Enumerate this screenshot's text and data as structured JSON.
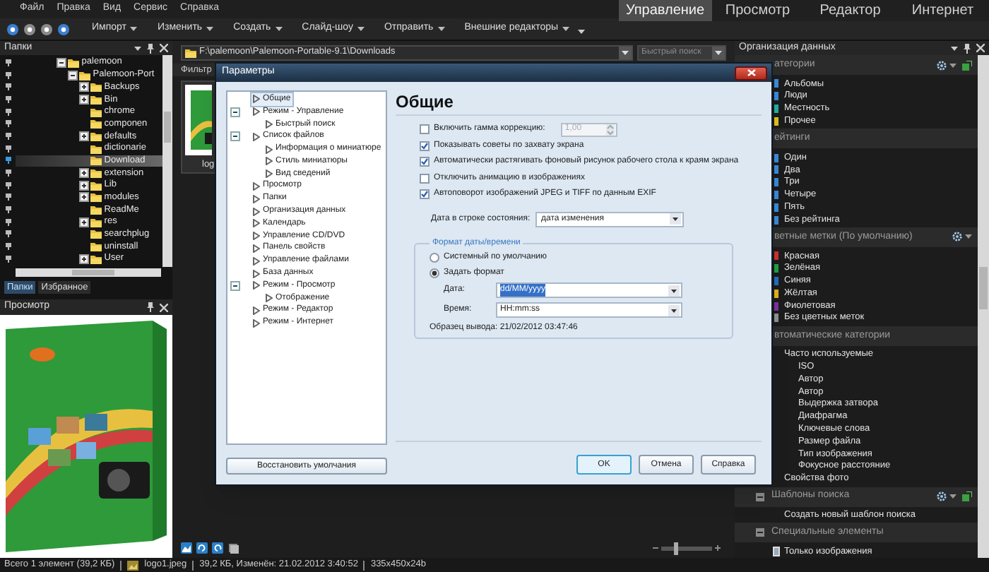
{
  "menu": [
    "Файл",
    "Правка",
    "Вид",
    "Сервис",
    "Справка"
  ],
  "modes": [
    {
      "label": "Управление",
      "selected": true
    },
    {
      "label": "Просмотр",
      "selected": false
    },
    {
      "label": "Редактор",
      "selected": false
    },
    {
      "label": "Интернет",
      "selected": false
    }
  ],
  "toolbar": [
    "Импорт",
    "Изменить",
    "Создать",
    "Слайд-шоу",
    "Отправить",
    "Внешние редакторы"
  ],
  "folders_panel": {
    "title": "Папки",
    "tree": [
      {
        "label": "palemoon",
        "kind": "expanded",
        "selected": false,
        "children": [
          {
            "label": "Palemoon-Port",
            "kind": "expanded",
            "selected": false,
            "children": [
              {
                "label": "Backups",
                "kind": "collapsed",
                "selected": false
              },
              {
                "label": "Bin",
                "kind": "collapsed",
                "selected": false
              },
              {
                "label": "chrome",
                "kind": "leaf",
                "selected": false
              },
              {
                "label": "componen",
                "kind": "leaf",
                "selected": false
              },
              {
                "label": "defaults",
                "kind": "collapsed",
                "selected": false
              },
              {
                "label": "dictionarie",
                "kind": "leaf",
                "selected": false
              },
              {
                "label": "Download",
                "kind": "leaf",
                "selected": true
              },
              {
                "label": "extension",
                "kind": "collapsed",
                "selected": false
              },
              {
                "label": "Lib",
                "kind": "collapsed",
                "selected": false
              },
              {
                "label": "modules",
                "kind": "collapsed",
                "selected": false
              },
              {
                "label": "ReadMe",
                "kind": "leaf",
                "selected": false
              },
              {
                "label": "res",
                "kind": "collapsed",
                "selected": false
              },
              {
                "label": "searchplug",
                "kind": "leaf",
                "selected": false
              },
              {
                "label": "uninstall",
                "kind": "leaf",
                "selected": false
              },
              {
                "label": "User",
                "kind": "collapsed",
                "selected": false
              }
            ]
          }
        ]
      }
    ],
    "tabs": [
      {
        "label": "Папки",
        "selected": true
      },
      {
        "label": "Избранное",
        "selected": false
      }
    ]
  },
  "preview_panel": {
    "title": "Просмотр"
  },
  "address_bar": {
    "path": "F:\\palemoon\\Palemoon-Portable-9.1\\Downloads",
    "quick_search": {
      "placeholder": "Быстрый поиск"
    }
  },
  "filter_label": "Фильтр",
  "thumbnail": {
    "caption": "log"
  },
  "zoom_slider": {
    "level": 0.3
  },
  "organizer": {
    "title": "Организация данных",
    "sections": [
      {
        "title": "атегории",
        "kind": "categories",
        "items": [
          {
            "label": "Альбомы",
            "color": "#3a8ad8"
          },
          {
            "label": "Люди",
            "color": "#3a8ad8"
          },
          {
            "label": "Местность",
            "color": "#20b0a0"
          },
          {
            "label": "Прочее",
            "color": "#e0c020"
          }
        ]
      },
      {
        "title": "ейтинги",
        "kind": "ratings",
        "items": [
          {
            "label": "Один"
          },
          {
            "label": "Два"
          },
          {
            "label": "Три"
          },
          {
            "label": "Четыре"
          },
          {
            "label": "Пять"
          },
          {
            "label": "Без рейтинга"
          }
        ]
      },
      {
        "title": "ветные метки (По умолчанию)",
        "kind": "color_labels",
        "items": [
          {
            "label": "Красная",
            "color": "#d03030"
          },
          {
            "label": "Зелёная",
            "color": "#20a040"
          },
          {
            "label": "Синяя",
            "color": "#2070c0"
          },
          {
            "label": "Жёлтая",
            "color": "#e0b020"
          },
          {
            "label": "Фиолетовая",
            "color": "#8030a0"
          },
          {
            "label": "Без цветных меток",
            "color": "#909090"
          }
        ]
      },
      {
        "title": "втоматические категории",
        "kind": "auto",
        "items": [
          {
            "label": "Часто используемые",
            "children": [
              {
                "label": "ISO"
              },
              {
                "label": "Автор"
              },
              {
                "label": "Автор"
              },
              {
                "label": "Выдержка затвора"
              },
              {
                "label": "Диафрагма"
              },
              {
                "label": "Ключевые слова"
              },
              {
                "label": "Размер файла"
              },
              {
                "label": "Тип изображения"
              },
              {
                "label": "Фокусное расстояние"
              }
            ]
          },
          {
            "label": "Свойства фото"
          }
        ]
      },
      {
        "title": "Шаблоны поиска",
        "kind": "templates",
        "items": [
          {
            "label": "Создать новый шаблон поиска"
          }
        ]
      },
      {
        "title": "Специальные элементы",
        "kind": "special",
        "items": [
          {
            "label": "Только изображения"
          }
        ]
      }
    ]
  },
  "status_bar": [
    {
      "text": "Всего 1 элемент (39,2 КБ)",
      "kind": "summary"
    },
    {
      "text": "logo1.jpeg",
      "kind": "file"
    },
    {
      "text": "39,2 КБ, Изменён: 21.02.2012 3:40:52",
      "kind": "info"
    },
    {
      "text": "335x450x24b",
      "kind": "info"
    }
  ],
  "dialog": {
    "title": "Параметры",
    "tree": [
      {
        "label": "Общие",
        "selected": true
      },
      {
        "label": "Режим - Управление",
        "selected": false,
        "children": [
          {
            "label": "Быстрый поиск",
            "selected": false
          }
        ]
      },
      {
        "label": "Список файлов",
        "selected": false,
        "children": [
          {
            "label": "Информация о миниатюре",
            "selected": false
          },
          {
            "label": "Стиль миниатюры",
            "selected": false
          },
          {
            "label": "Вид сведений",
            "selected": false
          }
        ]
      },
      {
        "label": "Просмотр",
        "selected": false
      },
      {
        "label": "Папки",
        "selected": false
      },
      {
        "label": "Организация данных",
        "selected": false
      },
      {
        "label": "Календарь",
        "selected": false
      },
      {
        "label": "Управление CD/DVD",
        "selected": false
      },
      {
        "label": "Панель свойств",
        "selected": false
      },
      {
        "label": "Управление файлами",
        "selected": false
      },
      {
        "label": "База данных",
        "selected": false
      },
      {
        "label": "Режим - Просмотр",
        "selected": false,
        "children": [
          {
            "label": "Отображение",
            "selected": false
          }
        ]
      },
      {
        "label": "Режим - Редактор",
        "selected": false
      },
      {
        "label": "Режим - Интернет",
        "selected": false
      }
    ],
    "restore_button": "Восстановить умолчания",
    "heading": "Общие",
    "options": [
      {
        "label": "Включить гамма коррекцию:",
        "checked": false,
        "spin": {
          "value": "1,00",
          "disabled": true
        }
      },
      {
        "label": "Показывать советы по захвату экрана",
        "checked": true
      },
      {
        "label": "Автоматически растягивать фоновый рисунок рабочего стола к краям экрана",
        "checked": true
      },
      {
        "label": "Отключить анимацию в изображениях",
        "checked": false
      },
      {
        "label": "Автоповорот изображений JPEG и TIFF по данным EXIF",
        "checked": true
      }
    ],
    "status_date": {
      "label": "Дата в строке состояния:",
      "value": "дата изменения"
    },
    "datetime_format": {
      "title": "Формат даты/времени",
      "modes": [
        {
          "label": "Системный по умолчанию",
          "selected": false
        },
        {
          "label": "Задать формат",
          "selected": true
        }
      ],
      "fields": [
        {
          "label": "Дата:",
          "value": "dd/MM/yyyy",
          "highlighted": true
        },
        {
          "label": "Время:",
          "value": "HH:mm:ss",
          "highlighted": false
        }
      ],
      "sample": "Образец вывода: 21/02/2012 03:47:46"
    },
    "buttons": [
      {
        "label": "OK",
        "default": true
      },
      {
        "label": "Отмена",
        "default": false
      },
      {
        "label": "Справка",
        "default": false
      }
    ]
  }
}
